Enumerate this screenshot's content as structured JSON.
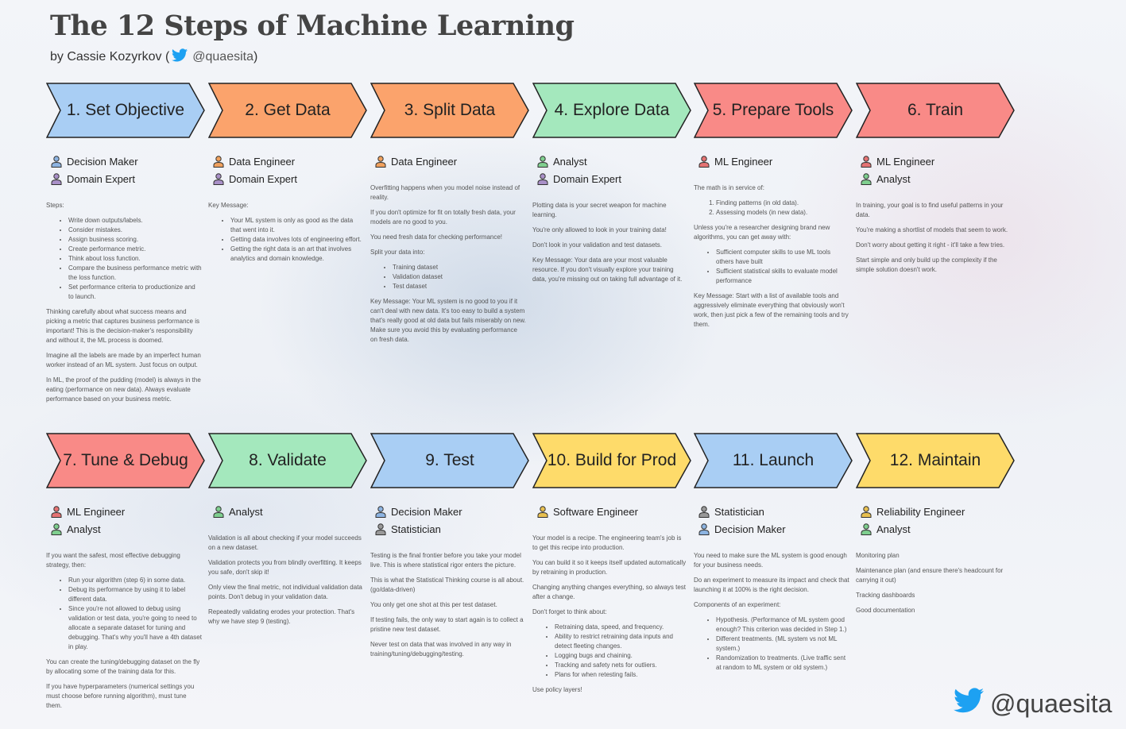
{
  "title": "The 12 Steps of Machine Learning",
  "byline": {
    "prefix": "by Cassie Kozyrkov (",
    "handle": "@quaesita",
    "suffix": ")"
  },
  "signature": "@quaesita",
  "colors": {
    "blue": "#a9cef4",
    "orange": "#fba36c",
    "green": "#a4e8bd",
    "red": "#f98a87",
    "yellow": "#fedb6a",
    "stroke": "#222222"
  },
  "steps": [
    {
      "label": "1. Set Objective",
      "color": "blue",
      "roles": [
        {
          "name": "Decision Maker",
          "color": "#8db4e2"
        },
        {
          "name": "Domain Expert",
          "color": "#a990c8"
        }
      ],
      "body": [
        {
          "t": "p",
          "text": "Steps:"
        },
        {
          "t": "ul",
          "items": [
            "Write down outputs/labels.",
            "Consider mistakes.",
            "Assign business scoring.",
            "Create performance metric.",
            "Think about loss function.",
            "Compare the business performance metric with the loss function.",
            "Set performance criteria to productionize and to launch."
          ]
        },
        {
          "t": "p",
          "text": "Thinking carefully about what success means and picking a metric that captures business performance is important! This is the decision-maker's responsibility and without it, the ML process is doomed."
        },
        {
          "t": "p",
          "text": "Imagine all the labels are made by an imperfect human worker instead of an ML system.  Just focus on output."
        },
        {
          "t": "p",
          "text": "In ML, the proof of the pudding (model) is always in the eating (performance on new data). Always evaluate performance based on your business metric."
        }
      ]
    },
    {
      "label": "2. Get Data",
      "color": "orange",
      "roles": [
        {
          "name": "Data Engineer",
          "color": "#f0a15e"
        },
        {
          "name": "Domain Expert",
          "color": "#a990c8"
        }
      ],
      "body": [
        {
          "t": "p",
          "text": "Key Message:"
        },
        {
          "t": "ul",
          "items": [
            "Your ML system is only as good as the data that went into it.",
            "Getting data involves lots of engineering effort.",
            "Getting the right data is an art that involves analytics and domain knowledge."
          ]
        }
      ]
    },
    {
      "label": "3. Split Data",
      "color": "orange",
      "roles": [
        {
          "name": "Data Engineer",
          "color": "#f0a15e"
        }
      ],
      "body": [
        {
          "t": "p",
          "text": "Overfitting happens when you model noise instead of reality."
        },
        {
          "t": "p",
          "text": "If you don't optimize for fit on totally fresh data, your models are no good to you."
        },
        {
          "t": "p",
          "text": "You need fresh data for checking performance!"
        },
        {
          "t": "p",
          "text": "Split your data into:"
        },
        {
          "t": "ul",
          "items": [
            "Training dataset",
            "Validation dataset",
            "Test dataset"
          ]
        },
        {
          "t": "p",
          "text": "Key Message: Your ML system is no good to you if it can't deal with new data. It's too easy to build a system that's really good at old data but fails miserably on new.  Make sure you avoid this by evaluating performance on fresh data."
        }
      ]
    },
    {
      "label": "4. Explore Data",
      "color": "green",
      "roles": [
        {
          "name": "Analyst",
          "color": "#7fcf8f"
        },
        {
          "name": "Domain Expert",
          "color": "#a990c8"
        }
      ],
      "body": [
        {
          "t": "p",
          "text": "Plotting data is your secret weapon for machine learning."
        },
        {
          "t": "p",
          "text": "You're only allowed to look in your training data!"
        },
        {
          "t": "p",
          "text": "Don't look in your validation and test datasets."
        },
        {
          "t": "p",
          "text": "Key Message: Your data are your most valuable resource. If you don't visually explore your training data, you're missing out on taking full advantage of it."
        }
      ]
    },
    {
      "label": "5. Prepare Tools",
      "color": "red",
      "roles": [
        {
          "name": "ML Engineer",
          "color": "#e57373"
        }
      ],
      "body": [
        {
          "t": "p",
          "text": "The math is in service of:"
        },
        {
          "t": "ol",
          "items": [
            "Finding patterns  (in old data).",
            "Assessing models (in new data)."
          ]
        },
        {
          "t": "p",
          "text": "Unless you're a researcher designing brand new algorithms, you can get away with:"
        },
        {
          "t": "ul",
          "items": [
            "Sufficient computer skills to use ML tools others have built",
            "Sufficient statistical skills to evaluate model performance"
          ]
        },
        {
          "t": "p",
          "text": "Key Message: Start with a list of available tools and aggressively eliminate everything that obviously won't work, then just pick a few of the remaining tools and try them."
        }
      ]
    },
    {
      "label": "6. Train",
      "color": "red",
      "roles": [
        {
          "name": "ML Engineer",
          "color": "#e57373"
        },
        {
          "name": "Analyst",
          "color": "#7fcf8f"
        }
      ],
      "body": [
        {
          "t": "p",
          "text": "In training, your goal is to find useful patterns in your data."
        },
        {
          "t": "p",
          "text": "You're making a shortlist of models that seem to work."
        },
        {
          "t": "p",
          "text": "Don't worry about getting it right - it'll take a few tries."
        },
        {
          "t": "p",
          "text": "Start simple and only build up the complexity if the simple solution doesn't work."
        }
      ]
    },
    {
      "label": "7. Tune & Debug",
      "color": "red",
      "roles": [
        {
          "name": "ML Engineer",
          "color": "#e57373"
        },
        {
          "name": "Analyst",
          "color": "#7fcf8f"
        }
      ],
      "body": [
        {
          "t": "p",
          "text": "If you want the safest, most effective debugging strategy, then:"
        },
        {
          "t": "ul",
          "items": [
            "Run your algorithm (step 6) in some data.",
            "Debug its performance by using it to label different data.",
            "Since you're not allowed to debug using validation or test data, you're going to need to allocate a separate dataset for tuning and debugging.  That's why you'll have a 4th dataset in play."
          ]
        },
        {
          "t": "p",
          "text": "You can create the tuning/debugging dataset on the fly by allocating some of the training data for this."
        },
        {
          "t": "p",
          "text": "If you have hyperparameters (numerical settings you must choose before running algorithm), must tune them."
        }
      ]
    },
    {
      "label": "8. Validate",
      "color": "green",
      "roles": [
        {
          "name": "Analyst",
          "color": "#7fcf8f"
        }
      ],
      "body": [
        {
          "t": "p",
          "text": "Validation is all about checking if your model succeeds on a new dataset."
        },
        {
          "t": "p",
          "text": "Validation protects you from blindly overfitting.  It keeps you safe, don't skip it!"
        },
        {
          "t": "p",
          "text": "Only view the final metric, not individual validation data points.  Don't debug in your validation data."
        },
        {
          "t": "p",
          "text": "Repeatedly validating erodes your protection.  That's why we have step 9 (testing)."
        }
      ]
    },
    {
      "label": "9. Test",
      "color": "blue",
      "roles": [
        {
          "name": "Decision Maker",
          "color": "#8db4e2"
        },
        {
          "name": "Statistician",
          "color": "#999999"
        }
      ],
      "body": [
        {
          "t": "p",
          "text": "Testing is the final frontier before you take your model live. This is where statistical rigor enters the picture."
        },
        {
          "t": "p",
          "text": "This is what the Statistical Thinking course is all about. (go/data-driven)"
        },
        {
          "t": "p",
          "text": "You only get one shot at this per test dataset."
        },
        {
          "t": "p",
          "text": "If testing fails, the only way to start again is to collect a pristine new test dataset."
        },
        {
          "t": "p",
          "text": "Never test on data that was involved in any way in training/tuning/debugging/testing."
        }
      ]
    },
    {
      "label": "10. Build for Prod",
      "color": "yellow",
      "roles": [
        {
          "name": "Software Engineer",
          "color": "#e8c050"
        }
      ],
      "body": [
        {
          "t": "p",
          "text": "Your model is a recipe. The engineering team's job is to get this recipe into production."
        },
        {
          "t": "p",
          "text": "You can build it so it keeps itself updated automatically by retraining in production."
        },
        {
          "t": "p",
          "text": "Changing anything changes everything, so always test after a change."
        },
        {
          "t": "p",
          "text": "Don't forget to think about:"
        },
        {
          "t": "ul",
          "items": [
            "Retraining data, speed, and frequency.",
            "Ability to restrict retraining data inputs and detect fleeting changes.",
            "Logging bugs and chaining.",
            "Tracking and safety nets for outliers.",
            "Plans for when retesting fails."
          ]
        },
        {
          "t": "p",
          "text": "Use policy layers!"
        }
      ]
    },
    {
      "label": "11. Launch",
      "color": "blue",
      "roles": [
        {
          "name": "Statistician",
          "color": "#999999"
        },
        {
          "name": "Decision Maker",
          "color": "#8db4e2"
        }
      ],
      "body": [
        {
          "t": "p",
          "text": "You need to make sure the ML system is good enough for your business needs."
        },
        {
          "t": "p",
          "text": "Do an experiment to measure its impact and check that launching it at 100% is the right decision."
        },
        {
          "t": "p",
          "text": "Components of an experiment:"
        },
        {
          "t": "ul",
          "items": [
            "Hypothesis. (Performance of ML system good enough? This criterion was decided in Step 1.)",
            "Different treatments. (ML system vs not ML system.)",
            "Randomization to treatments. (Live traffic sent at random to ML system or old system.)"
          ]
        }
      ]
    },
    {
      "label": "12. Maintain",
      "color": "yellow",
      "roles": [
        {
          "name": "Reliability Engineer",
          "color": "#e8c050"
        },
        {
          "name": "Analyst",
          "color": "#7fcf8f"
        }
      ],
      "body": [
        {
          "t": "p",
          "text": "Monitoring plan"
        },
        {
          "t": "p",
          "text": "Maintenance plan (and ensure there's headcount for carrying it out)"
        },
        {
          "t": "p",
          "text": "Tracking dashboards"
        },
        {
          "t": "p",
          "text": "Good documentation"
        }
      ]
    }
  ]
}
